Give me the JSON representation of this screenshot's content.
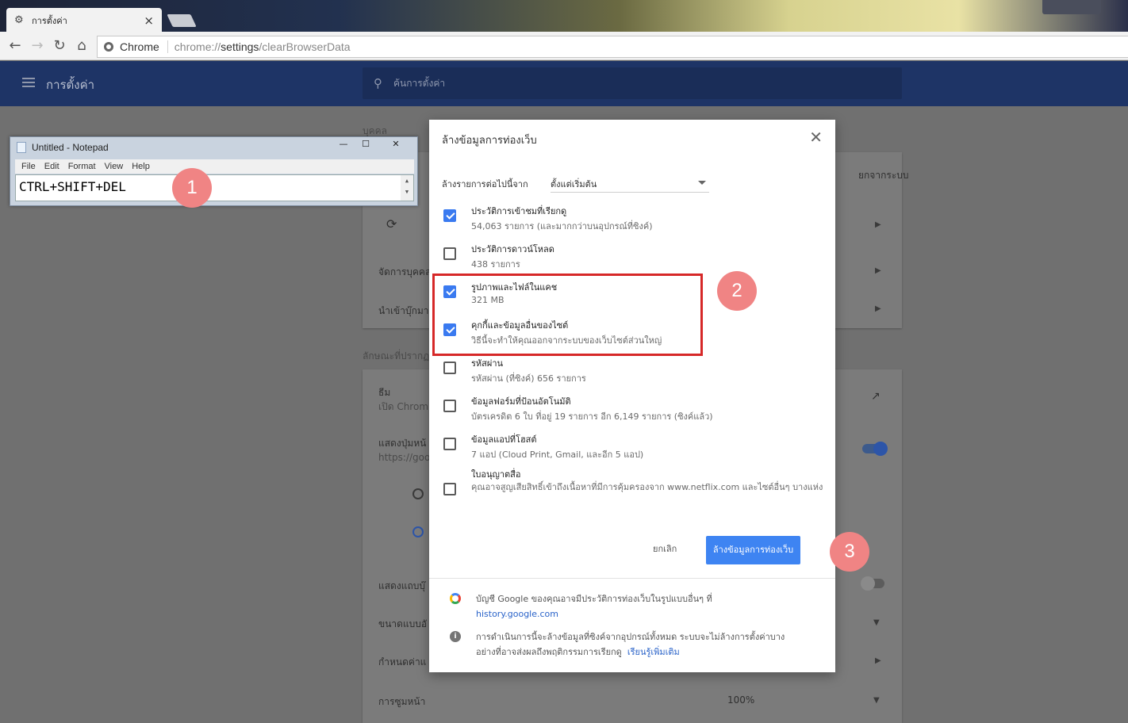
{
  "browser": {
    "tab_title": "การตั้งค่า",
    "tab_close": "×",
    "omnibox_chip": "Chrome",
    "url_prefix": "chrome://",
    "url_host": "settings",
    "url_path": "/clearBrowserData"
  },
  "settings": {
    "title": "การตั้งค่า",
    "search_placeholder": "ค้นการตั้งค่า",
    "section_people": "บุคคล",
    "row_sync_suffix": "ยกจากระบบ",
    "row_manage_people": "จัดการบุคคล",
    "row_import": "นำเข้าบุ๊กมา",
    "section_appearance": "ลักษณะที่ปรากฏ",
    "row_theme": "ธีม",
    "row_theme_sub": "เปิด Chrom",
    "row_home_button": "แสดงปุ่มหน้",
    "row_home_url": "https://goo",
    "row_bookmarks_bar": "แสดงแถบบุ๊",
    "row_font_size": "ขนาดแบบอั",
    "row_customize_fonts": "กำหนดค่าแ",
    "row_page_zoom": "การซูมหน้า",
    "page_zoom_value": "100%"
  },
  "notepad": {
    "title": "Untitled - Notepad",
    "menu": [
      "File",
      "Edit",
      "Format",
      "View",
      "Help"
    ],
    "content": "CTRL+SHIFT+DEL",
    "minimize": "—",
    "maximize": "☐",
    "close": "✕"
  },
  "steps": [
    "1",
    "2",
    "3"
  ],
  "dialog": {
    "title": "ล้างข้อมูลการท่องเว็บ",
    "close": "✕",
    "range_label": "ล้างรายการต่อไปนี้จาก",
    "range_value": "ตั้งแต่เริ่มต้น",
    "options": [
      {
        "title": "ประวัติการเข้าชมที่เรียกดู",
        "detail": "54,063 รายการ (และมากกว่าบนอุปกรณ์ที่ซิงค์)",
        "checked": true
      },
      {
        "title": "ประวัติการดาวน์โหลด",
        "detail": "438 รายการ",
        "checked": false
      },
      {
        "title": "รูปภาพและไฟล์ในแคช",
        "detail": "321 MB",
        "checked": true
      },
      {
        "title": "คุกกี้และข้อมูลอื่นของไซต์",
        "detail": "วิธีนี้จะทำให้คุณออกจากระบบของเว็บไซต์ส่วนใหญ่",
        "checked": true
      },
      {
        "title": "รหัสผ่าน",
        "detail": "รหัสผ่าน (ที่ซิงค์) 656 รายการ",
        "checked": false
      },
      {
        "title": "ข้อมูลฟอร์มที่ป้อนอัตโนมัติ",
        "detail": "บัตรเครดิต 6 ใบ ที่อยู่ 19 รายการ อีก 6,149 รายการ (ซิงค์แล้ว)",
        "checked": false
      },
      {
        "title": "ข้อมูลแอปที่โฮสต์",
        "detail": "7 แอป (Cloud Print, Gmail, และอีก 5 แอป)",
        "checked": false
      },
      {
        "title": "ใบอนุญาตสื่อ",
        "detail": "คุณอาจสูญเสียสิทธิ์เข้าถึงเนื้อหาที่มีการคุ้มครองจาก www.netflix.com และไซต์อื่นๆ บางแห่ง",
        "checked": false
      }
    ],
    "cancel_label": "ยกเลิก",
    "clear_label": "ล้างข้อมูลการท่องเว็บ",
    "footer_google_text": "บัญชี Google ของคุณอาจมีประวัติการท่องเว็บในรูปแบบอื่นๆ ที่",
    "footer_google_link": "history.google.com",
    "footer_info_text_1": "การดำเนินการนี้จะล้างข้อมูลที่ซิงค์จากอุปกรณ์ทั้งหมด ระบบจะไม่ล้างการตั้งค่าบาง",
    "footer_info_text_2": "อย่างที่อาจส่งผลถึงพฤติกรรมการเรียกดู",
    "footer_info_link": "เรียนรู้เพิ่มเติม"
  },
  "colors": {
    "accent": "#3e84f2",
    "highlight_border": "#d62828",
    "step_marker": "#f08484",
    "settings_header": "#1e3466"
  }
}
